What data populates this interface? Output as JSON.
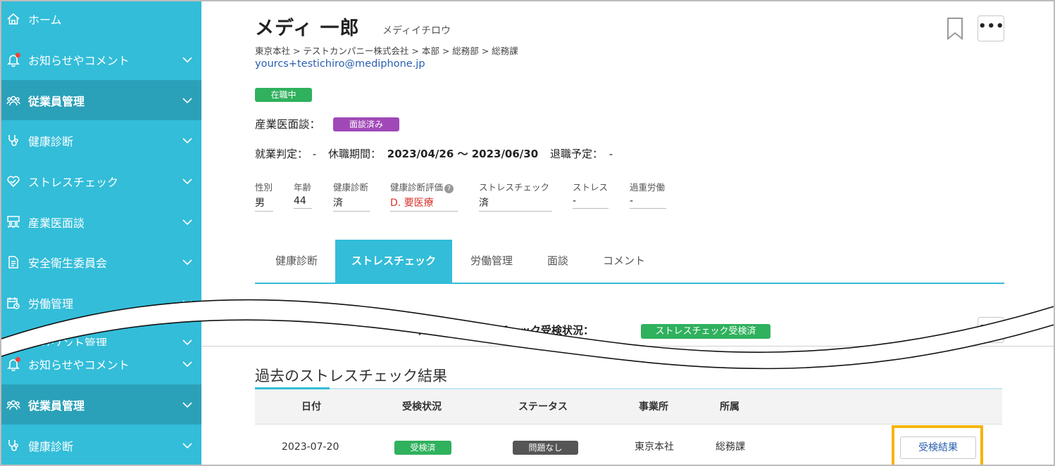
{
  "sidebar_top": {
    "items": [
      {
        "label": "ホーム",
        "icon": "home-icon",
        "chevron": false,
        "active": false
      },
      {
        "label": "お知らせやコメント",
        "icon": "bell-icon",
        "chevron": true,
        "active": false
      },
      {
        "label": "従業員管理",
        "icon": "users-icon",
        "chevron": true,
        "active": true
      },
      {
        "label": "健康診断",
        "icon": "stethoscope-icon",
        "chevron": true,
        "active": false
      },
      {
        "label": "ストレスチェック",
        "icon": "heart-icon",
        "chevron": true,
        "active": false
      },
      {
        "label": "産業医面談",
        "icon": "meeting-icon",
        "chevron": true,
        "active": false
      },
      {
        "label": "安全衛生委員会",
        "icon": "document-icon",
        "chevron": true,
        "active": false
      },
      {
        "label": "労働管理",
        "icon": "calendar-clock-icon",
        "chevron": true,
        "active": false
      },
      {
        "label": "アカウント管理",
        "icon": "account-icon",
        "chevron": true,
        "active": false
      }
    ]
  },
  "sidebar_bottom": {
    "items": [
      {
        "label": "お知らせやコメント",
        "icon": "bell-icon",
        "active": false
      },
      {
        "label": "従業員管理",
        "icon": "users-icon",
        "active": true
      },
      {
        "label": "健康診断",
        "icon": "stethoscope-icon",
        "active": false
      }
    ]
  },
  "profile": {
    "name": "メディ 一郎",
    "kana": "メディイチロウ",
    "breadcrumb": "東京本社 > テストカンパニー株式会社 > 本部 > 総務部 > 総務課",
    "email": "yourcs+testichiro@mediphone.jp",
    "status": "在職中",
    "sangyo_label": "産業医面談：",
    "sangyo_badge": "面談済み",
    "shugyo_label": "就業判定：",
    "shugyo_value": "-",
    "kyushoku_label": "休職期間：",
    "kyushoku_value": "2023/04/26 ～ 2023/06/30",
    "taishoku_label": "退職予定：",
    "taishoku_value": "-",
    "more_label": "•••"
  },
  "info": [
    {
      "label": "性別",
      "value": "男"
    },
    {
      "label": "年齢",
      "value": "44"
    },
    {
      "label": "健康診断",
      "value": "済"
    },
    {
      "label": "健康診断評価",
      "value": "D. 要医療"
    },
    {
      "label": "ストレスチェック",
      "value": "済"
    },
    {
      "label": "ストレス",
      "value": "-"
    },
    {
      "label": "過重労働",
      "value": "-"
    }
  ],
  "help_glyph": "?",
  "tabs": [
    {
      "label": "健康診断",
      "active": false
    },
    {
      "label": "ストレスチェック",
      "active": true
    },
    {
      "label": "労働管理",
      "active": false
    },
    {
      "label": "面談",
      "active": false
    },
    {
      "label": "コメント",
      "active": false
    }
  ],
  "this_year": {
    "label": "今年度のストレスチェック受検状況：",
    "badge": "ストレスチェック受検済"
  },
  "past": {
    "title": "過去のストレスチェック結果",
    "headers": [
      "日付",
      "受検状況",
      "ステータス",
      "事業所",
      "所属"
    ],
    "rows": [
      {
        "date": "2023-07-20",
        "status": "受検済",
        "result_status": "問題なし",
        "office": "東京本社",
        "dept": "総務課",
        "button": "受検結果"
      }
    ]
  },
  "colors": {
    "sidebar": "#33bdd9",
    "sidebar_active": "#2aa1b9",
    "green": "#2fb15d",
    "purple": "#a048b8",
    "highlight": "#f5b40c"
  }
}
